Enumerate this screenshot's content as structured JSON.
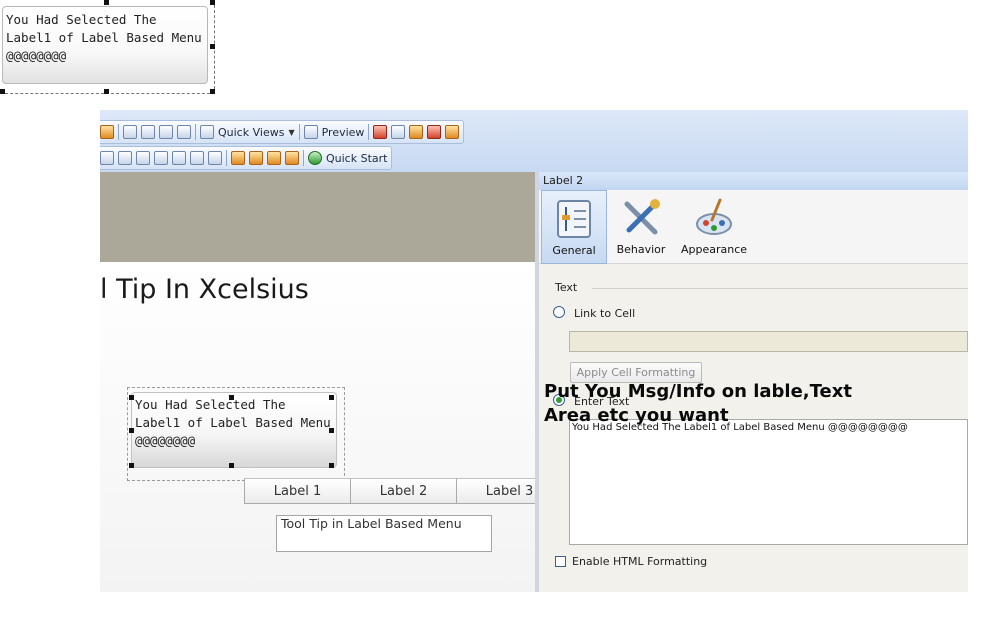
{
  "top_tooltip": {
    "text": "You Had Selected The\nLabel1 of Label Based Menu\n@@@@@@@@"
  },
  "toolbar": {
    "quick_views_label": "Quick Views",
    "preview_label": "Preview",
    "quick_start_label": "Quick Start"
  },
  "canvas": {
    "title": "l Tip In Xcelsius",
    "tooltip_text": "You Had Selected The\nLabel1 of Label Based Menu\n@@@@@@@@",
    "menu_labels": [
      "Label 1",
      "Label 2",
      "Label 3"
    ],
    "content_text": "Tool Tip in Label Based Menu"
  },
  "panel": {
    "title": "Label 2",
    "tabs": [
      {
        "label": "General",
        "icon": "general-icon",
        "active": true
      },
      {
        "label": "Behavior",
        "icon": "behavior-icon",
        "active": false
      },
      {
        "label": "Appearance",
        "icon": "appearance-icon",
        "active": false
      }
    ],
    "text_group_label": "Text",
    "link_to_cell_label": "Link to Cell",
    "apply_cell_formatting_label": "Apply Cell Formatting",
    "enter_text_label": "Enter Text",
    "enter_text_value": "You Had Selected The Label1 of Label Based Menu @@@@@@@@",
    "enable_html_label": "Enable HTML Formatting"
  },
  "annotation": "Put You Msg/Info on lable,Text\nArea etc you want",
  "colors": {
    "canvas_grey": "#aba899",
    "toolbar_blue": "#c7d9f2",
    "radio_on": "#2f9b3a"
  }
}
